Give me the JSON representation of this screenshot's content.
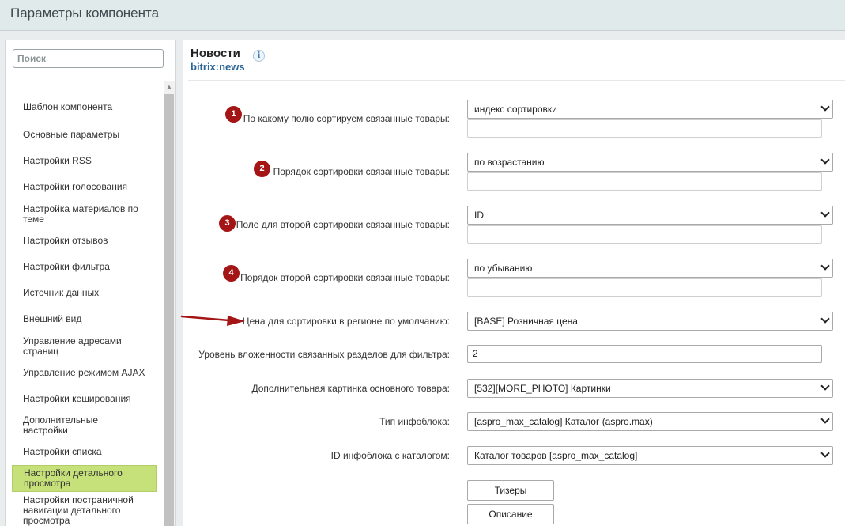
{
  "window": {
    "title": "Параметры компонента"
  },
  "sidebar": {
    "search_placeholder": "Поиск",
    "items": [
      {
        "label": "Шаблон компонента"
      },
      {
        "label": "Основные параметры"
      },
      {
        "label": "Настройки RSS"
      },
      {
        "label": "Настройки голосования"
      },
      {
        "label": "Настройка материалов по теме"
      },
      {
        "label": "Настройки отзывов"
      },
      {
        "label": "Настройки фильтра"
      },
      {
        "label": "Источник данных"
      },
      {
        "label": "Внешний вид"
      },
      {
        "label": "Управление адресами страниц"
      },
      {
        "label": "Управление режимом AJAX"
      },
      {
        "label": "Настройки кеширования"
      },
      {
        "label": "Дополнительные настройки"
      },
      {
        "label": "Настройки списка"
      },
      {
        "label": "Настройки детального просмотра",
        "active": true
      },
      {
        "label": "Настройки постраничной навигации детального просмотра"
      }
    ]
  },
  "header": {
    "title": "Новости",
    "subtitle": "bitrix:news",
    "info_glyph": "i"
  },
  "form": {
    "rows": [
      {
        "badge": "1",
        "label": "По какому полю сортируем связанные товары:",
        "value": "индекс сортировки"
      },
      {
        "badge": "2",
        "label": "Порядок сортировки связанные товары:",
        "value": "по возрастанию"
      },
      {
        "badge": "3",
        "label": "Поле для второй сортировки связанные товары:",
        "value": "ID"
      },
      {
        "badge": "4",
        "label": "Порядок второй сортировки связанные товары:",
        "value": "по убыванию"
      },
      {
        "label": "Цена для сортировки в регионе по умолчанию:",
        "value": "[BASE] Розничная цена"
      },
      {
        "label": "Уровень вложенности связанных разделов для фильтра:",
        "value": "2"
      },
      {
        "label": "Дополнительная картинка основного товара:",
        "value": "[532][MORE_PHOTO] Картинки"
      },
      {
        "label": "Тип инфоблока:",
        "value": "[aspro_max_catalog] Каталог (aspro.max)"
      },
      {
        "label": "ID инфоблока с каталогом:",
        "value": "Каталог товаров [aspro_max_catalog]"
      }
    ],
    "buttons": {
      "teasers": "Тизеры",
      "description": "Описание"
    }
  },
  "colors": {
    "badge": "#a41616",
    "active_menu": "#c6e07a",
    "subtitle": "#2a6597"
  },
  "icons": {
    "info": "info-icon",
    "annotation_arrow": "arrow-icon",
    "select_chevron": "chevron-down-icon"
  }
}
